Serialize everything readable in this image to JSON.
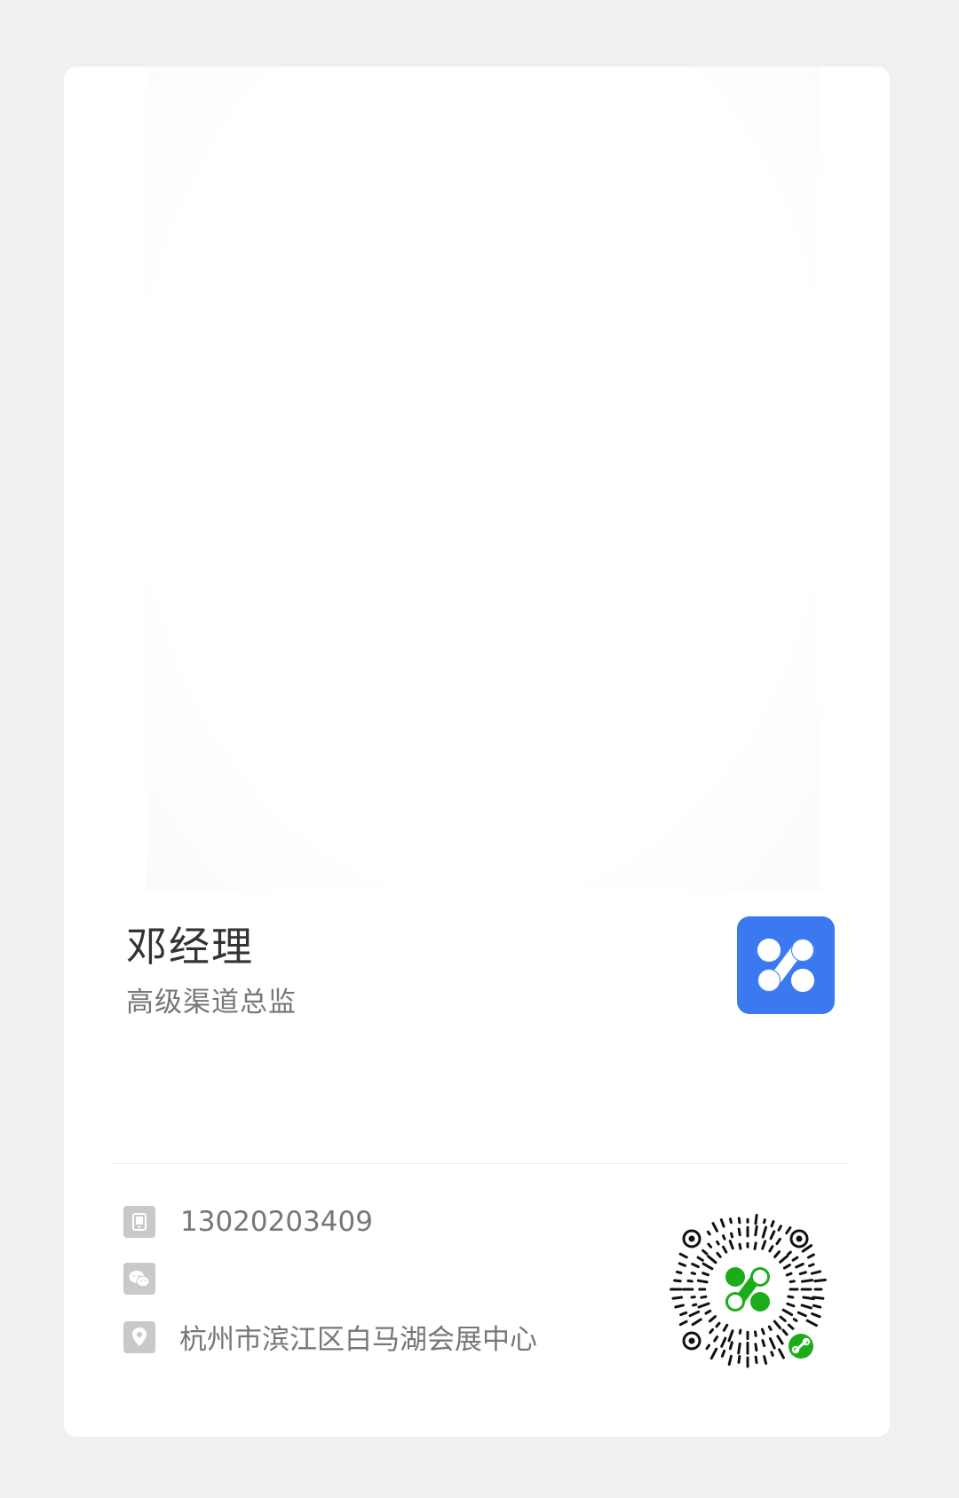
{
  "profile": {
    "name": "邓经理",
    "title": "高级渠道总监"
  },
  "contact": {
    "phone": "13020203409",
    "wechat": "",
    "address": "杭州市滨江区白马湖会展中心"
  },
  "icons": {
    "phone": "phone-icon",
    "wechat": "wechat-icon",
    "location": "location-pin-icon",
    "app_logo": "app-logo-icon",
    "mini_program": "mini-program-icon"
  },
  "colors": {
    "background": "#eff0f2",
    "card": "#ffffff",
    "app_logo": "#3a79f0",
    "qr_accent": "#1aad19",
    "icon_gray": "#c9c9c9"
  }
}
